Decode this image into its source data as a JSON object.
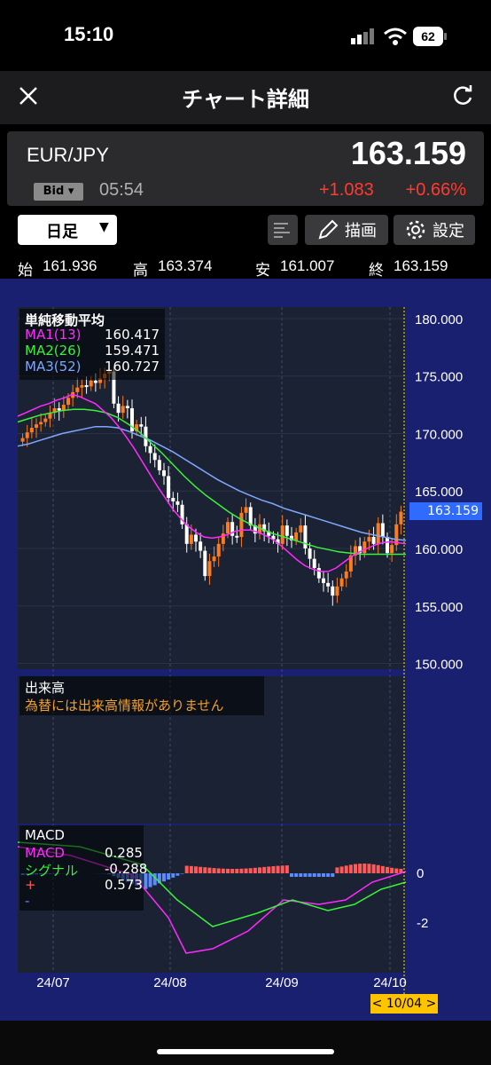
{
  "status": {
    "time": "15:10",
    "battery": "62"
  },
  "nav": {
    "title": "チャート詳細"
  },
  "quote": {
    "pair": "EUR/JPY",
    "price": "163.159",
    "bid_label": "Bid",
    "time": "05:54",
    "change": "+1.083",
    "change_pct": "+0.66%"
  },
  "toolbar": {
    "period": "日足",
    "draw": "描画",
    "settings": "設定"
  },
  "ohlc": {
    "open_label": "始",
    "open": "161.936",
    "high_label": "高",
    "high": "163.374",
    "low_label": "安",
    "low": "161.007",
    "close_label": "終",
    "close": "163.159"
  },
  "panels": {
    "ma": {
      "title": "単純移動平均",
      "items": [
        {
          "label": "MA1(13)",
          "value": "160.417",
          "color": "#ff2bff"
        },
        {
          "label": "MA2(26)",
          "value": "159.471",
          "color": "#3cf03c"
        },
        {
          "label": "MA3(52)",
          "value": "160.727",
          "color": "#7fa7ff"
        }
      ]
    },
    "volume": {
      "title": "出来高",
      "message": "為替には出来高情報がありません"
    },
    "macd": {
      "title": "MACD",
      "items": [
        {
          "label": "MACD",
          "value": "0.285",
          "color": "#ff2bff"
        },
        {
          "label": "シグナル",
          "value": "-0.288",
          "color": "#3cf03c"
        },
        {
          "label": "+",
          "value": "0.573",
          "color": "#ff5a5a"
        },
        {
          "label": "-",
          "value": "",
          "color": "#5a8cff"
        }
      ]
    }
  },
  "chart_data": {
    "type": "candlestick",
    "y_ticks": [
      "180.000",
      "175.000",
      "170.000",
      "165.000",
      "160.000",
      "155.000",
      "150.000"
    ],
    "ylim": [
      149.5,
      181.0
    ],
    "current_price": "163.159",
    "x_ticks": [
      "24/07",
      "24/08",
      "24/09",
      "24/10"
    ],
    "cursor_label": "< 10/04 >",
    "macd_ticks": [
      "0",
      "-2"
    ],
    "candles_close": [
      169.6,
      170.1,
      170.5,
      170.8,
      171.0,
      171.3,
      171.8,
      172.2,
      172.0,
      172.5,
      173.1,
      173.6,
      174.0,
      174.2,
      174.1,
      174.6,
      174.4,
      174.8,
      175.2,
      175.4,
      172.6,
      171.8,
      172.4,
      172.2,
      170.2,
      170.8,
      170.6,
      168.9,
      168.3,
      167.7,
      166.8,
      166.3,
      164.4,
      164.1,
      163.8,
      162.1,
      160.4,
      161.2,
      160.6,
      159.8,
      157.6,
      158.9,
      159.3,
      160.4,
      161.3,
      162.3,
      161.1,
      161.0,
      163.1,
      163.6,
      162.0,
      161.3,
      162.1,
      161.5,
      161.1,
      160.8,
      160.4,
      162.0,
      161.1,
      160.7,
      161.4,
      162.0,
      160.0,
      159.1,
      158.3,
      157.4,
      157.0,
      156.7,
      155.9,
      156.7,
      157.4,
      158.0,
      159.4,
      160.2,
      159.6,
      160.6,
      161.0,
      160.4,
      162.2,
      161.0,
      159.6,
      160.3,
      162.1,
      163.2
    ],
    "ma13": [
      171.5,
      171.8,
      172.1,
      172.4,
      172.6,
      172.9,
      173.1,
      173.4,
      173.2,
      172.9,
      172.6,
      172.0,
      171.4,
      170.6,
      169.7,
      168.7,
      167.6,
      166.5,
      165.4,
      164.4,
      163.4,
      162.6,
      161.9,
      161.4,
      161.0,
      160.9,
      161.0,
      161.2,
      161.5,
      161.6,
      161.6,
      161.4,
      161.1,
      160.7,
      160.2,
      159.6,
      159.0,
      158.5,
      158.2,
      158.0,
      158.0,
      158.3,
      158.8,
      159.3,
      159.7,
      160.0,
      160.3,
      160.5,
      160.6,
      160.5,
      160.4
    ],
    "ma26": [
      171.0,
      171.3,
      171.6,
      171.8,
      172.0,
      172.1,
      172.1,
      172.0,
      171.8,
      171.4,
      170.8,
      170.1,
      169.2,
      168.3,
      167.3,
      166.3,
      165.4,
      164.6,
      163.9,
      163.2,
      162.6,
      162.1,
      161.7,
      161.3,
      161.0,
      160.7,
      160.4,
      160.1,
      159.9,
      159.7,
      159.6,
      159.5,
      159.5,
      159.5,
      159.5,
      159.5
    ],
    "ma52": [
      168.9,
      169.1,
      169.4,
      169.7,
      170.0,
      170.2,
      170.4,
      170.6,
      170.6,
      170.5,
      170.2,
      169.8,
      169.4,
      168.9,
      168.4,
      167.8,
      167.2,
      166.6,
      166.0,
      165.5,
      165.0,
      164.6,
      164.2,
      163.9,
      163.5,
      163.2,
      162.9,
      162.6,
      162.3,
      162.0,
      161.7,
      161.4,
      161.2,
      161.0,
      160.8,
      160.7
    ]
  }
}
